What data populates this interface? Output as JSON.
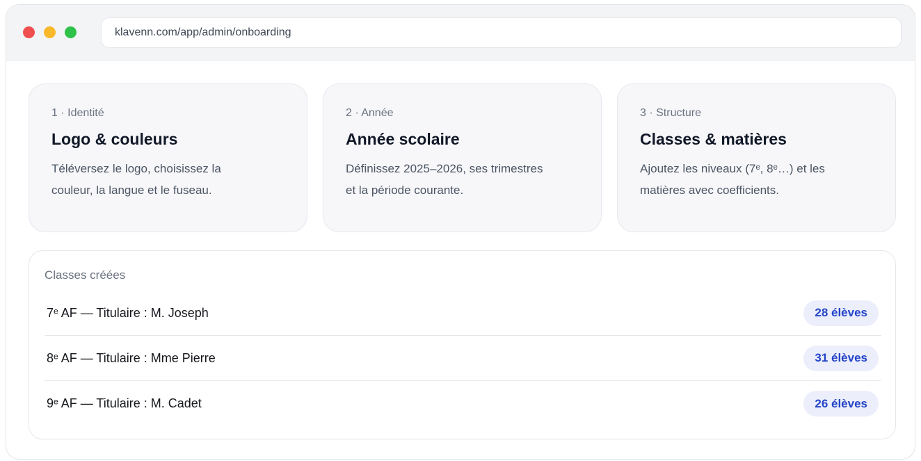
{
  "browser": {
    "traffic_lights": [
      {
        "icon": "close-dot-icon",
        "color": "#f04f4f"
      },
      {
        "icon": "minimize-dot-icon",
        "color": "#f8b82a"
      },
      {
        "icon": "maximize-dot-icon",
        "color": "#2fc24a"
      }
    ],
    "url": "klavenn.com/app/admin/onboarding"
  },
  "theme": {
    "badge_text": "#2445c7",
    "badge_background": "#eceefc"
  },
  "steps": [
    {
      "label": "1 · Identité",
      "title": "Logo & couleurs",
      "description": [
        "Téléversez le logo, choisissez la",
        "couleur, la langue et le fuseau."
      ]
    },
    {
      "label": "2 · Année",
      "title": "Année scolaire",
      "description": [
        "Définissez 2025–2026, ses trimestres",
        "et la période courante."
      ]
    },
    {
      "label": "3 · Structure",
      "title": "Classes & matières",
      "description": [
        "Ajoutez les niveaux (7ᵉ, 8ᵉ…) et les",
        "matières avec coefficients."
      ]
    }
  ],
  "classes": {
    "title": "Classes créées",
    "rows": [
      {
        "label": "7ᵉ AF — Titulaire : M. Joseph",
        "count": "28 élèves"
      },
      {
        "label": "8ᵉ AF — Titulaire : Mme Pierre",
        "count": "31 élèves"
      },
      {
        "label": "9ᵉ AF — Titulaire : M. Cadet",
        "count": "26 élèves"
      }
    ]
  }
}
